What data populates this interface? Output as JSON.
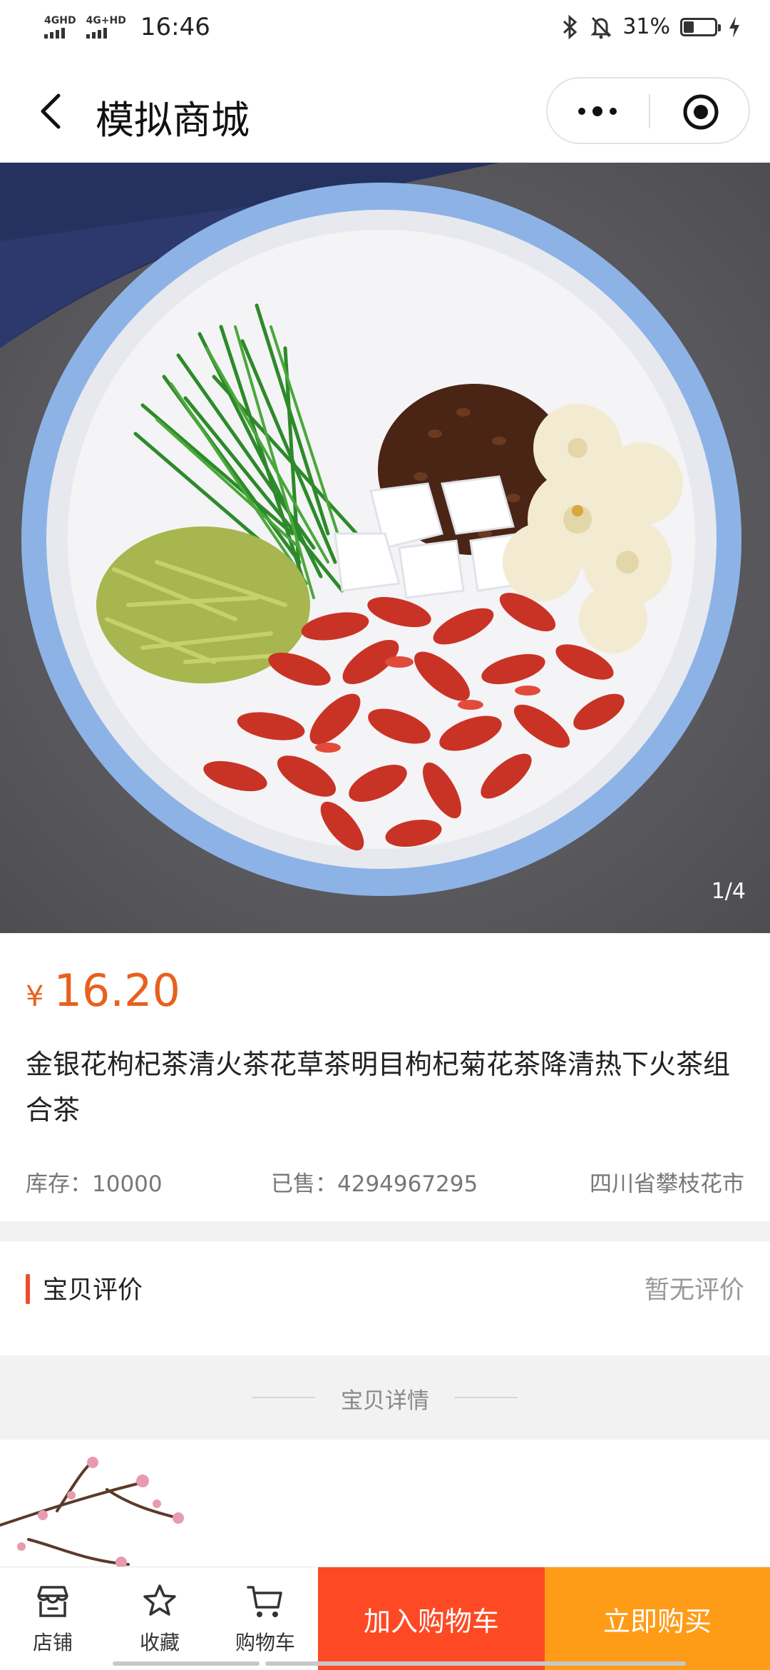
{
  "status": {
    "net1": "4GHD",
    "net2": "4G+HD",
    "time": "16:46",
    "battery": "31%",
    "battery_level": 0.31
  },
  "nav": {
    "title": "模拟商城"
  },
  "gallery": {
    "counter": "1/4"
  },
  "product": {
    "currency": "¥",
    "price": "16.20",
    "title": "金银花枸杞茶清火茶花草茶明目枸杞菊花茶降清热下火茶组合茶",
    "stock": "库存：10000",
    "sold": "已售：4294967295",
    "location": "四川省攀枝花市"
  },
  "reviews": {
    "label": "宝贝评价",
    "empty": "暂无评价"
  },
  "details": {
    "label": "宝贝详情"
  },
  "bottom": {
    "store": "店铺",
    "favorite": "收藏",
    "cart": "购物车",
    "add_to_cart": "加入购物车",
    "buy_now": "立即购买"
  },
  "colors": {
    "price": "#e8601d",
    "add_to_cart": "#fd4a25",
    "buy_now": "#ff9c17",
    "accent_bar": "#ee4d2d"
  }
}
